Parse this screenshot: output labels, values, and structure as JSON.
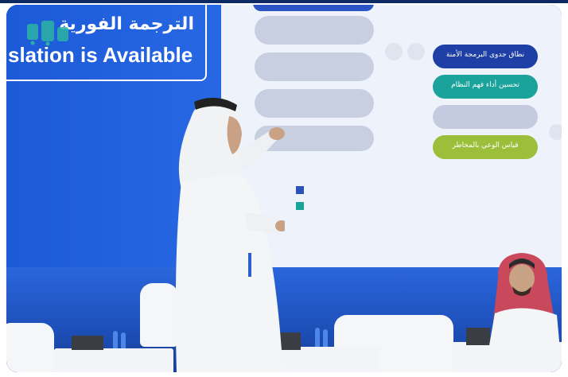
{
  "banner": {
    "arabic_text": "الترجمة الفورية",
    "english_text": "slation is Available"
  },
  "logo": {
    "icon": "logo-icon"
  },
  "screen": {
    "right_pills": [
      {
        "label": "نطاق جدوى البرمجة الأمنة",
        "color": "#1e3fa6"
      },
      {
        "label": "تحسين أداء فهم النظام",
        "color": "#1aa39a"
      },
      {
        "label": "",
        "color": "#c4cbe0"
      },
      {
        "label": "قياس الوعي بالمخاطر",
        "color": "#9bbf3a"
      }
    ],
    "legend": [
      {
        "label": "",
        "color": "#2a52b8"
      },
      {
        "label": "",
        "color": "#1aa39a"
      }
    ]
  },
  "colors": {
    "stage_blue": "#1f5fd6",
    "screen_bg": "#eef2fb",
    "thobe_white": "#f4f5f7",
    "shemagh_red": "#c9485c"
  }
}
